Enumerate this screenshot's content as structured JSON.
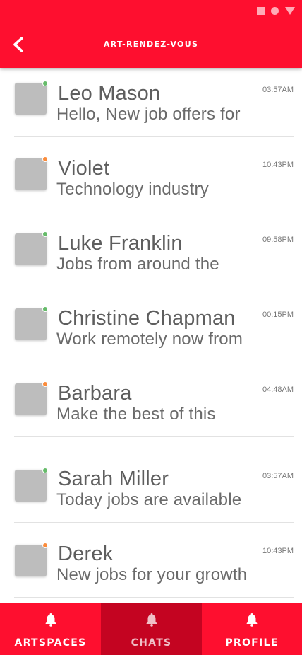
{
  "header": {
    "title": "ART-RENDEZ-VOUS",
    "back_icon": "chevron-left-icon",
    "background_color": "#fe0f2f"
  },
  "status_bar": {
    "icons": [
      "square-icon",
      "circle-icon",
      "triangle-icon"
    ]
  },
  "status_colors": {
    "online": "#66bb6a",
    "away": "#fb8c3c"
  },
  "chats": [
    {
      "name": "Leo Mason",
      "preview": "Hello, New job offers for",
      "time": "03:57AM",
      "status": "online"
    },
    {
      "name": "Violet",
      "preview": "Technology industry",
      "time": "10:43PM",
      "status": "away"
    },
    {
      "name": "Luke Franklin",
      "preview": "Jobs from around the",
      "time": "09:58PM",
      "status": "online"
    },
    {
      "name": "Christine Chapman",
      "preview": "Work remotely now from",
      "time": "00:15PM",
      "status": "online"
    },
    {
      "name": "Barbara",
      "preview": "Make the best of this",
      "time": "04:48AM",
      "status": "away"
    },
    {
      "name": "Sarah Miller",
      "preview": "Today jobs are available",
      "time": "03:57AM",
      "status": "online"
    },
    {
      "name": "Derek",
      "preview": "New jobs for your growth",
      "time": "10:43PM",
      "status": "away"
    }
  ],
  "bottom_nav": {
    "tabs": [
      {
        "label": "ARTSPACES",
        "icon": "bell-icon",
        "active": false
      },
      {
        "label": "CHATS",
        "icon": "bell-icon",
        "active": true
      },
      {
        "label": "PROFILE",
        "icon": "bell-icon",
        "active": false
      }
    ],
    "active_color": "#c40421"
  }
}
